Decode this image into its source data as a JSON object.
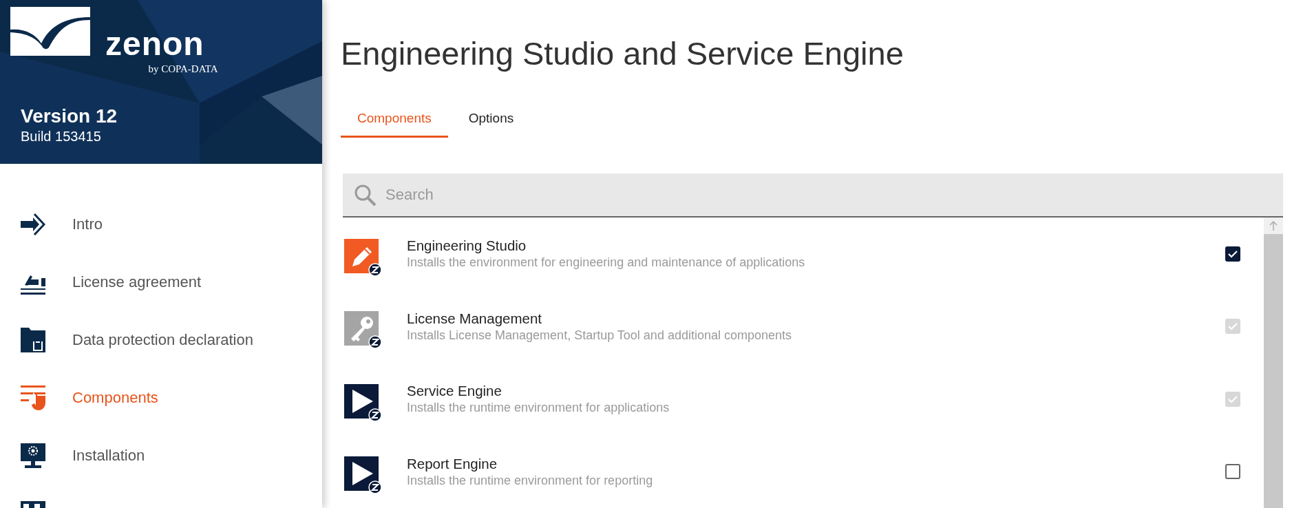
{
  "sidebar": {
    "logo": {
      "name": "zenon",
      "tagline": "by COPA-DATA"
    },
    "version": "Version 12",
    "build": "Build 153415",
    "items": [
      {
        "kind": "arrow",
        "label": "Intro",
        "selected": false
      },
      {
        "kind": "sign",
        "label": "License agreement",
        "selected": false
      },
      {
        "kind": "folder-lock",
        "label": "Data protection declaration",
        "selected": false
      },
      {
        "kind": "components",
        "label": "Components",
        "selected": true
      },
      {
        "kind": "monitor",
        "label": "Installation",
        "selected": false
      },
      {
        "kind": "flag",
        "selected": false
      }
    ]
  },
  "main": {
    "title": "Engineering Studio and Service Engine",
    "tabs": [
      {
        "label": "Components",
        "selected": true
      },
      {
        "label": "Options",
        "selected": false
      }
    ],
    "search": {
      "placeholder": "Search"
    },
    "components": [
      {
        "kind": "pencil",
        "name": "Engineering Studio",
        "description": "Installs the environment for engineering and maintenance of applications",
        "checked": true,
        "disabled": false
      },
      {
        "kind": "key",
        "name": "License Management",
        "description": "Installs License Management, Startup Tool and additional components",
        "checked": true,
        "disabled": true
      },
      {
        "kind": "play",
        "name": "Service Engine",
        "description": "Installs the runtime environment for applications",
        "checked": true,
        "disabled": true
      },
      {
        "kind": "play",
        "name": "Report Engine",
        "description": "Installs the runtime environment for reporting",
        "checked": false,
        "disabled": false
      }
    ]
  }
}
